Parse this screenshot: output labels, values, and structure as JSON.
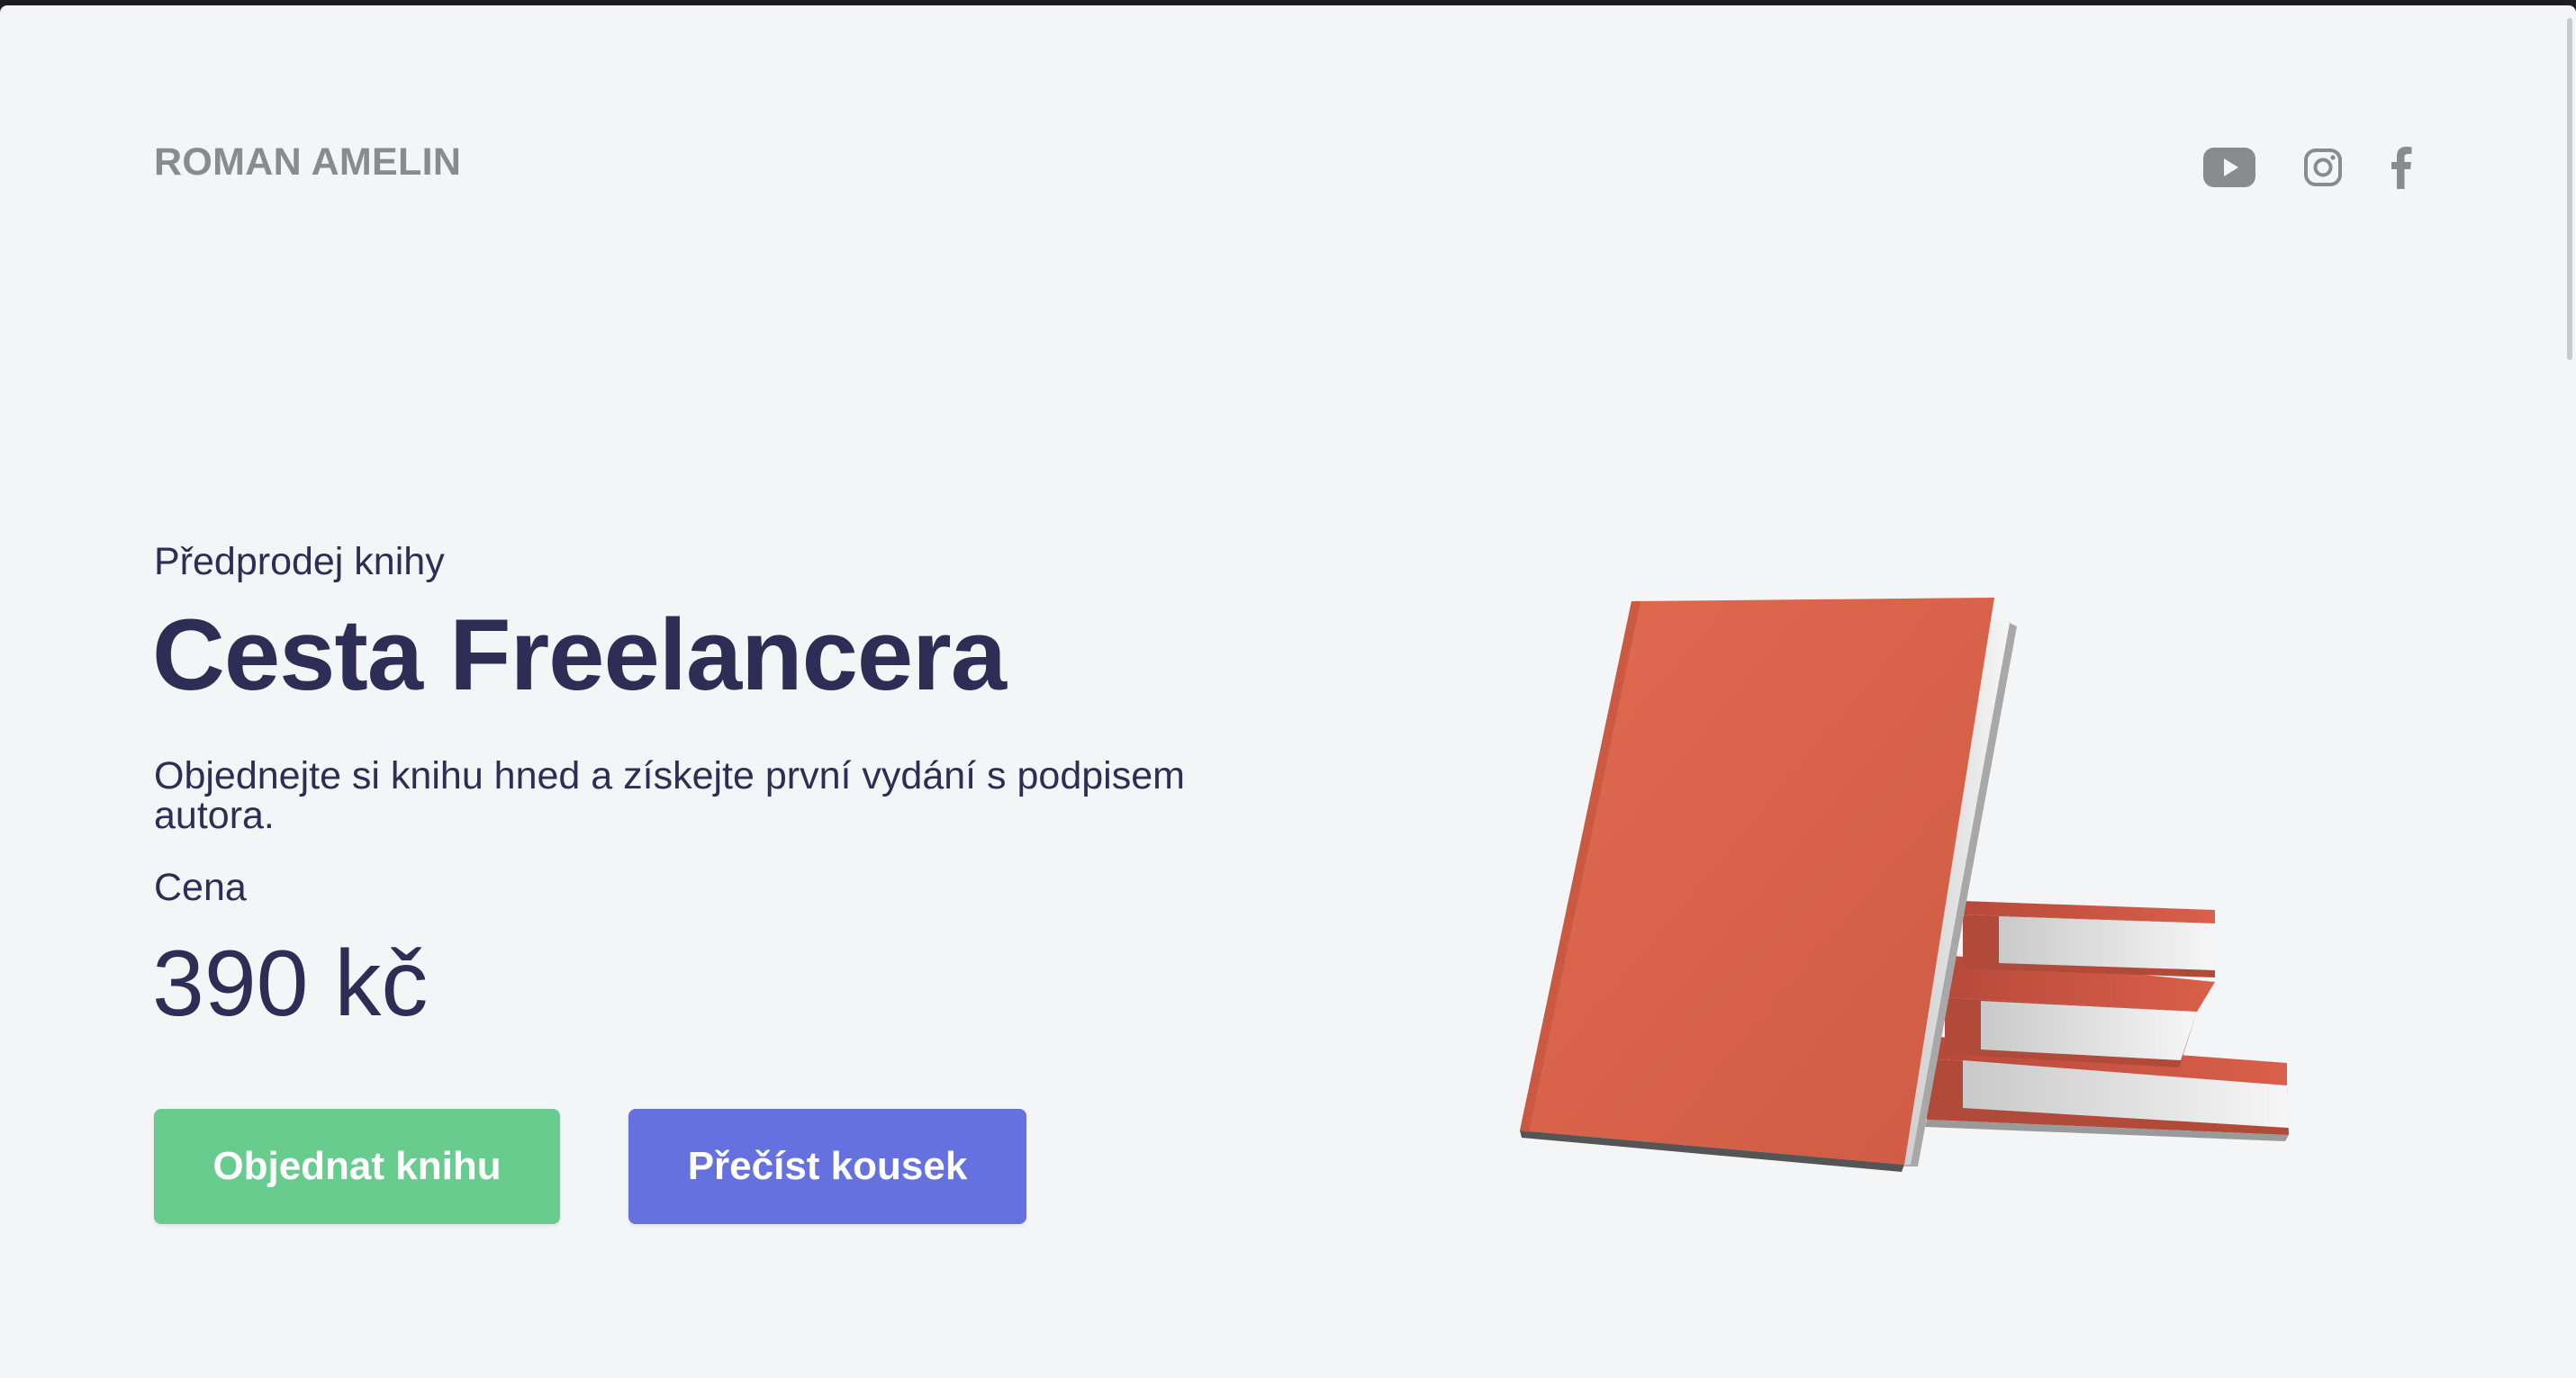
{
  "header": {
    "brand": "ROMAN AMELIN",
    "social_icons": [
      "youtube-icon",
      "instagram-icon",
      "facebook-icon"
    ]
  },
  "hero": {
    "kicker": "Předprodej knihy",
    "title": "Cesta Freelancera",
    "description": "Objednejte si knihu hned a získejte první vydání s podpisem autora.",
    "price_label": "Cena",
    "price": "390 kč",
    "buttons": {
      "order_label": "Objednat knihu",
      "read_label": "Přečíst kousek"
    }
  },
  "colors": {
    "text_dark": "#2e2d55",
    "brand_gray": "#8a8b8f",
    "button_green": "#67cc8e",
    "button_blue": "#6671e0",
    "book_orange": "#d9604a",
    "background": "#f4f5f7"
  }
}
